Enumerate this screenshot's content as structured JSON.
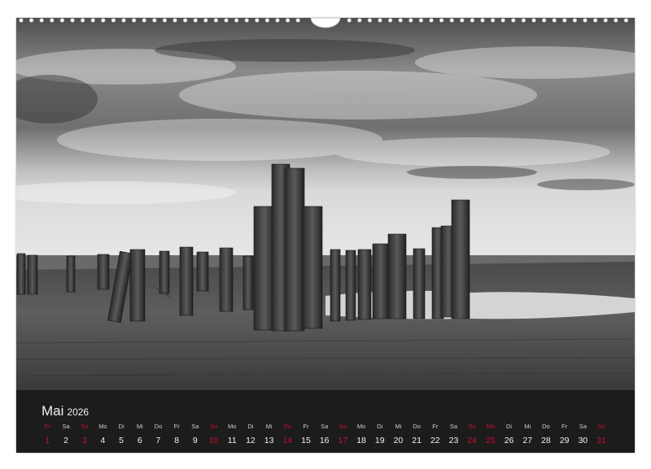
{
  "calendar": {
    "month": "Mai",
    "year": "2026",
    "highlight_color": "#c8102e",
    "days": [
      {
        "wd": "Fr",
        "d": "1",
        "hol": true
      },
      {
        "wd": "Sa",
        "d": "2",
        "hol": false
      },
      {
        "wd": "So",
        "d": "3",
        "hol": true
      },
      {
        "wd": "Mo",
        "d": "4",
        "hol": false
      },
      {
        "wd": "Di",
        "d": "5",
        "hol": false
      },
      {
        "wd": "Mi",
        "d": "6",
        "hol": false
      },
      {
        "wd": "Do",
        "d": "7",
        "hol": false
      },
      {
        "wd": "Fr",
        "d": "8",
        "hol": false
      },
      {
        "wd": "Sa",
        "d": "9",
        "hol": false
      },
      {
        "wd": "So",
        "d": "10",
        "hol": true
      },
      {
        "wd": "Mo",
        "d": "11",
        "hol": false
      },
      {
        "wd": "Di",
        "d": "12",
        "hol": false
      },
      {
        "wd": "Mi",
        "d": "13",
        "hol": false
      },
      {
        "wd": "Do",
        "d": "14",
        "hol": true
      },
      {
        "wd": "Fr",
        "d": "15",
        "hol": false
      },
      {
        "wd": "Sa",
        "d": "16",
        "hol": false
      },
      {
        "wd": "So",
        "d": "17",
        "hol": true
      },
      {
        "wd": "Mo",
        "d": "18",
        "hol": false
      },
      {
        "wd": "Di",
        "d": "19",
        "hol": false
      },
      {
        "wd": "Mi",
        "d": "20",
        "hol": false
      },
      {
        "wd": "Do",
        "d": "21",
        "hol": false
      },
      {
        "wd": "Fr",
        "d": "22",
        "hol": false
      },
      {
        "wd": "Sa",
        "d": "23",
        "hol": false
      },
      {
        "wd": "So",
        "d": "24",
        "hol": true
      },
      {
        "wd": "Mo",
        "d": "25",
        "hol": true
      },
      {
        "wd": "Di",
        "d": "26",
        "hol": false
      },
      {
        "wd": "Mi",
        "d": "27",
        "hol": false
      },
      {
        "wd": "Do",
        "d": "28",
        "hol": false
      },
      {
        "wd": "Fr",
        "d": "29",
        "hol": false
      },
      {
        "wd": "Sa",
        "d": "30",
        "hol": false
      },
      {
        "wd": "So",
        "d": "31",
        "hol": true
      }
    ]
  }
}
